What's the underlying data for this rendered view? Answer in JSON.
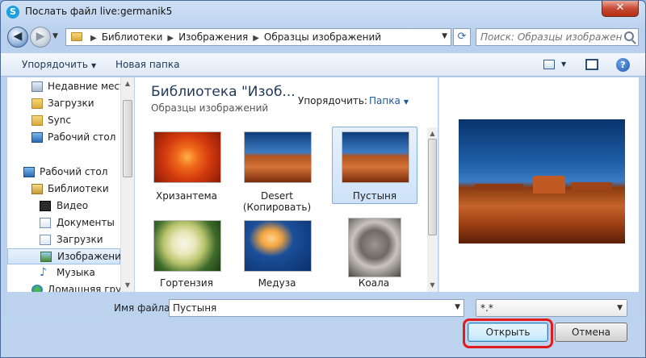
{
  "window": {
    "title": "Послать файл live:germanik5",
    "close_glyph": "✕"
  },
  "address": {
    "crumbs": [
      "Библиотеки",
      "Изображения",
      "Образцы изображений"
    ],
    "search_placeholder": "Поиск: Образцы изображений"
  },
  "toolbar": {
    "organize_label": "Упорядочить",
    "new_folder_label": "Новая папка"
  },
  "nav": {
    "items": [
      {
        "label": "Недавние места",
        "icon": "recent-places-icon"
      },
      {
        "label": "Загрузки",
        "icon": "downloads-folder-icon"
      },
      {
        "label": "Sync",
        "icon": "sync-folder-icon"
      },
      {
        "label": "Рабочий стол",
        "icon": "desktop-icon"
      },
      {
        "label": "Рабочий стол",
        "icon": "desktop-icon"
      },
      {
        "label": "Библиотеки",
        "icon": "libraries-icon"
      },
      {
        "label": "Видео",
        "icon": "video-icon"
      },
      {
        "label": "Документы",
        "icon": "documents-icon"
      },
      {
        "label": "Загрузки",
        "icon": "downloads-icon"
      },
      {
        "label": "Изображения",
        "icon": "pictures-icon"
      },
      {
        "label": "Музыка",
        "icon": "music-icon"
      },
      {
        "label": "Домашняя груп",
        "icon": "homegroup-icon"
      }
    ]
  },
  "content": {
    "library_title": "Библиотека \"Изоб...",
    "library_subtitle": "Образцы изображений",
    "arrange_label": "Упорядочить:",
    "arrange_value": "Папка",
    "files": [
      {
        "label": "Хризантема",
        "icon": "chrysanthemum-thumbnail"
      },
      {
        "label": "Desert (Копировать)",
        "icon": "desert-copy-thumbnail"
      },
      {
        "label": "Пустыня",
        "icon": "desert-thumbnail"
      },
      {
        "label": "Гортензия",
        "icon": "hydrangea-thumbnail"
      },
      {
        "label": "Медуза",
        "icon": "jellyfish-thumbnail"
      },
      {
        "label": "Коала",
        "icon": "koala-thumbnail"
      }
    ]
  },
  "footer": {
    "filename_label": "Имя файла:",
    "filename_value": "Пустыня",
    "filetype_value": "*.*",
    "open_label": "Открыть",
    "cancel_label": "Отмена"
  },
  "colors": {
    "highlight": "#e11b1b",
    "accent": "#1e5aa0"
  }
}
